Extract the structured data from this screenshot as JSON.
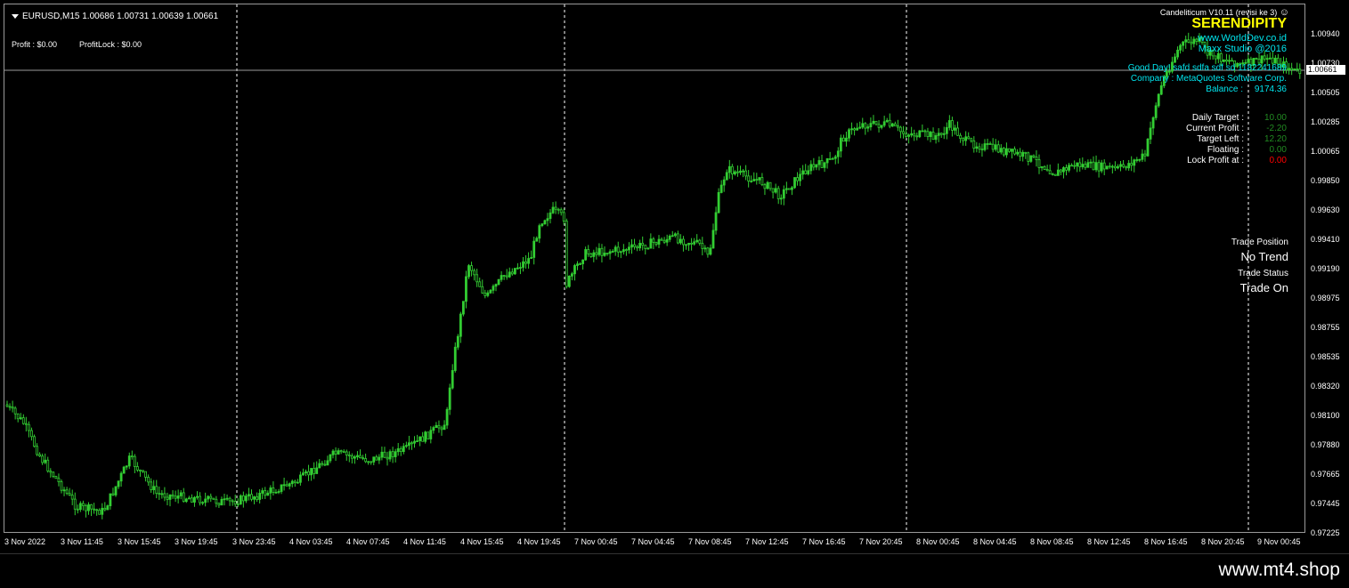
{
  "header": {
    "symbol_line": "EURUSD,M15  1.00686 1.00731 1.00639 1.00661"
  },
  "top_left": {
    "profit": "Profit : $0.00",
    "profit_lock": "ProfitLock : $0.00"
  },
  "ea_panel": {
    "title": "Candeliticum V10.11 (revisi ke 3)",
    "smiley": "☺",
    "name": "SERENDIPITY",
    "website": "www.WorldDev.co.id",
    "studio": "Maxx Studio @2016",
    "greeting": "Good Day! safd    sdfa sdf  sd  1182241689",
    "company": "Company : MetaQuotes Software Corp.",
    "balance_label": "Balance :",
    "balance_value": "9174.36"
  },
  "stats": {
    "daily_target_label": "Daily Target :",
    "daily_target_value": "10.00",
    "current_profit_label": "Current Profit :",
    "current_profit_value": "-2.20",
    "target_left_label": "Target Left :",
    "target_left_value": "12.20",
    "floating_label": "Floating :",
    "floating_value": "0.00",
    "lock_profit_label": "Lock Profit at :",
    "lock_profit_value": "0.00"
  },
  "trade": {
    "position_label": "Trade Position",
    "position_value": "No Trend",
    "status_label": "Trade Status",
    "status_value": "Trade On"
  },
  "price_axis": {
    "labels": [
      "1.00940",
      "1.00730",
      "1.00505",
      "1.00285",
      "1.00065",
      "0.99850",
      "0.99630",
      "0.99410",
      "0.99190",
      "0.98975",
      "0.98755",
      "0.98535",
      "0.98320",
      "0.98100",
      "0.97880",
      "0.97665",
      "0.97445",
      "0.97225"
    ],
    "current": "1.00661"
  },
  "time_axis": {
    "labels": [
      "3 Nov 2022",
      "3 Nov 11:45",
      "3 Nov 15:45",
      "3 Nov 19:45",
      "3 Nov 23:45",
      "4 Nov 03:45",
      "4 Nov 07:45",
      "4 Nov 11:45",
      "4 Nov 15:45",
      "4 Nov 19:45",
      "7 Nov 00:45",
      "7 Nov 04:45",
      "7 Nov 08:45",
      "7 Nov 12:45",
      "7 Nov 16:45",
      "7 Nov 20:45",
      "8 Nov 00:45",
      "8 Nov 04:45",
      "8 Nov 08:45",
      "8 Nov 12:45",
      "8 Nov 16:45",
      "8 Nov 20:45",
      "9 Nov 00:45"
    ]
  },
  "colors": {
    "candle": "#32cd32",
    "cyan": "#00e5ee",
    "yellow": "#ffff00",
    "green_value": "#228b22",
    "red_value": "#ff0000",
    "separator": "#ffffff"
  },
  "watermark": "www.mt4.shop"
}
